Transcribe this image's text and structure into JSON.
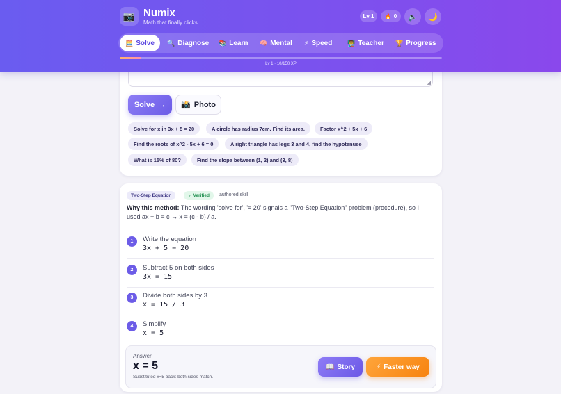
{
  "header": {
    "logo_icon": "📷",
    "title": "Numix",
    "tagline": "Math that finally clicks.",
    "level_badge": "Lv 1",
    "streak_icon": "🔥",
    "streak_count": "0",
    "sound_icon": "🔈",
    "theme_icon": "🌙"
  },
  "tabs": [
    {
      "icon": "🧮",
      "label": "Solve",
      "active": true
    },
    {
      "icon": "🔍",
      "label": "Diagnose"
    },
    {
      "icon": "📚",
      "label": "Learn"
    },
    {
      "icon": "🧠",
      "label": "Mental"
    },
    {
      "icon": "⚡",
      "label": "Speed"
    },
    {
      "icon": "👨‍🏫",
      "label": "Teacher"
    },
    {
      "icon": "🏆",
      "label": "Progress"
    }
  ],
  "xp": {
    "text": "Lv 1 · 10/150 XP",
    "fraction": 0.067
  },
  "solve": {
    "textarea_resize": "◢",
    "solve_label": "Solve",
    "solve_arrow": "→",
    "photo_icon": "📸",
    "photo_label": "Photo"
  },
  "examples": [
    "Solve for x in 3x + 5 = 20",
    "A circle has radius 7cm. Find its area.",
    "Factor x^2 + 5x + 6",
    "Find the roots of x^2 - 5x + 6 = 0",
    "A right triangle has legs 3 and 4, find the hypotenuse",
    "What is 15% of 80?",
    "Find the slope between (1, 2) and (3, 8)"
  ],
  "result": {
    "skill_badge": "Two-Step Equation",
    "verified_check": "✓",
    "verified_label": "Verified",
    "authored": "authored skill",
    "why_label": "Why this method:",
    "why_text": "The wording 'solve for', '= 20' signals a \"Two-Step Equation\" problem (procedure), so I used ax + b = c → x = (c - b) / a.",
    "steps": [
      {
        "n": "1",
        "title": "Write the equation",
        "expr": "3x + 5 = 20"
      },
      {
        "n": "2",
        "title": "Subtract 5 on both sides",
        "expr": "3x = 15"
      },
      {
        "n": "3",
        "title": "Divide both sides by 3",
        "expr": "x = 15 / 3"
      },
      {
        "n": "4",
        "title": "Simplify",
        "expr": "x = 5"
      }
    ],
    "answer_label": "Answer",
    "answer_value": "x = 5",
    "answer_note": "Substituted x=5 back: both sides match.",
    "story_icon": "📖",
    "story_label": "Story",
    "faster_icon": "⚡",
    "faster_label": "Faster way"
  }
}
